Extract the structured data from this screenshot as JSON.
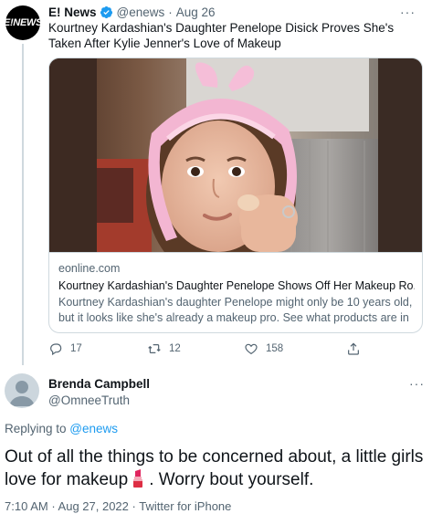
{
  "tweet": {
    "avatar_text": "E!NEWS",
    "author_name": "E! News",
    "author_handle": "@enews",
    "separator": "·",
    "date": "Aug 26",
    "more": "···",
    "text": "Kourtney Kardashian's Daughter Penelope Disick Proves She's Taken After Kylie Jenner's Love of Makeup",
    "card": {
      "domain": "eonline.com",
      "title": "Kourtney Kardashian's Daughter Penelope Shows Off Her Makeup Ro...",
      "description": "Kourtney Kardashian's daughter Penelope might only be 10 years old, but it looks like she's already a makeup pro. See what products are in ..."
    },
    "actions": {
      "replies": "17",
      "retweets": "12",
      "likes": "158"
    }
  },
  "reply": {
    "author_name": "Brenda Campbell",
    "author_handle": "@OmneeTruth",
    "more": "···",
    "replying_prefix": "Replying to ",
    "replying_to": "@enews",
    "text_part1": "Out of all the things to be concerned about, a little girls love for makeup",
    "text_part2": ". Worry bout yourself.",
    "emoji": "lipstick",
    "time": "7:10 AM",
    "separator": " · ",
    "date": "Aug 27, 2022",
    "source": "Twitter for iPhone"
  },
  "colors": {
    "accent": "#1d9bf0",
    "text_primary": "#0f1419",
    "text_secondary": "#536471",
    "border": "#cfd9de"
  },
  "icons": [
    "verified-badge-icon",
    "reply-icon",
    "retweet-icon",
    "like-icon",
    "share-icon",
    "more-icon",
    "lipstick-emoji-icon"
  ]
}
